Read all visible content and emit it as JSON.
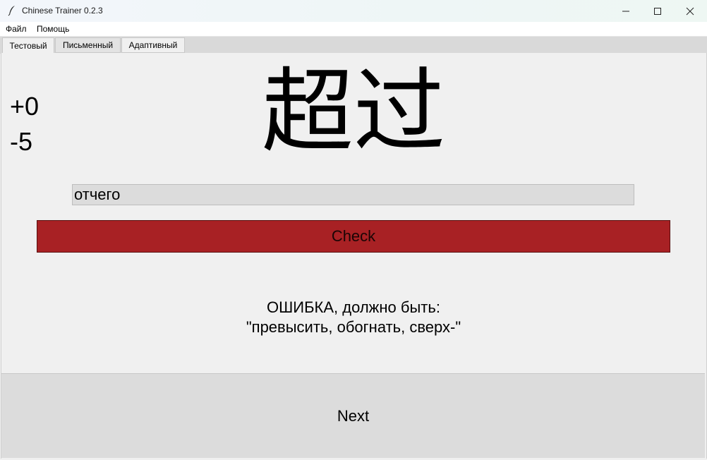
{
  "window": {
    "title": "Chinese Trainer 0.2.3",
    "icon": "feather-icon"
  },
  "menu": {
    "items": [
      "Файл",
      "Помощь"
    ]
  },
  "tabs": [
    {
      "label": "Тестовый",
      "active": true
    },
    {
      "label": "Письменный",
      "active": false
    },
    {
      "label": "Адаптивный",
      "active": false
    }
  ],
  "score": {
    "correct": "+0",
    "wrong": "-5"
  },
  "question": {
    "hanzi": "超过"
  },
  "answer": {
    "value": "отчего"
  },
  "check_button": {
    "label": "Check",
    "color": "#a82124"
  },
  "feedback": {
    "line1": "ОШИБКА, должно быть:",
    "line2": "\"превысить, обогнать, сверх-\""
  },
  "next_button": {
    "label": "Next"
  }
}
